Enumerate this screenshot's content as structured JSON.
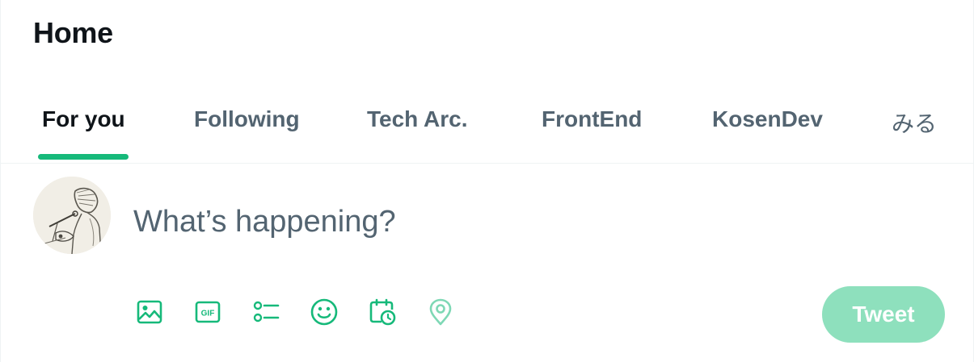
{
  "header": {
    "title": "Home"
  },
  "tabs": [
    {
      "label": "For you",
      "active": true
    },
    {
      "label": "Following",
      "active": false
    },
    {
      "label": "Tech Arc.",
      "active": false
    },
    {
      "label": "FrontEnd",
      "active": false
    },
    {
      "label": "KosenDev",
      "active": false
    },
    {
      "label": "みる",
      "active": false
    }
  ],
  "composer": {
    "placeholder": "What’s happening?",
    "value": "",
    "tools": [
      "image-icon",
      "gif-icon",
      "poll-icon",
      "emoji-icon",
      "schedule-icon",
      "location-icon"
    ],
    "tweet_label": "Tweet"
  },
  "colors": {
    "accent": "#16b97a",
    "accent_disabled": "#8ee0bd",
    "text_primary": "#0f1419",
    "text_secondary": "#536471",
    "divider": "#eff3f4"
  }
}
